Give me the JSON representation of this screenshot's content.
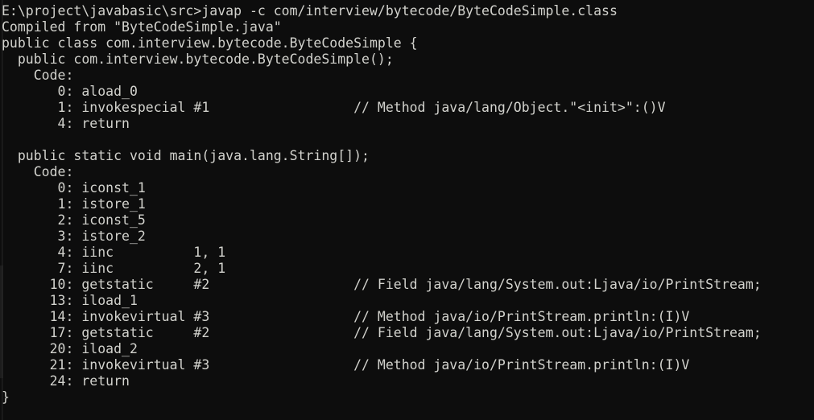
{
  "terminal": {
    "window_title": "javap -c com/interview/bytecode/ByteCodeSimple.class",
    "background_color": "#0d0d0d",
    "foreground_color": "#d2d2cd",
    "prompt_path": "E:\\project\\javabasic\\src",
    "prompt_symbol": ">",
    "command": "javap -c com/interview/bytecode/ByteCodeSimple.class",
    "lines": [
      "E:\\project\\javabasic\\src>javap -c com/interview/bytecode/ByteCodeSimple.class",
      "Compiled from \"ByteCodeSimple.java\"",
      "public class com.interview.bytecode.ByteCodeSimple {",
      "  public com.interview.bytecode.ByteCodeSimple();",
      "    Code:",
      "       0: aload_0",
      "       1: invokespecial #1                  // Method java/lang/Object.\"<init>\":()V",
      "       4: return",
      "",
      "  public static void main(java.lang.String[]);",
      "    Code:",
      "       0: iconst_1",
      "       1: istore_1",
      "       2: iconst_5",
      "       3: istore_2",
      "       4: iinc          1, 1",
      "       7: iinc          2, 1",
      "      10: getstatic     #2                  // Field java/lang/System.out:Ljava/io/PrintStream;",
      "      13: iload_1",
      "      14: invokevirtual #3                  // Method java/io/PrintStream.println:(I)V",
      "      17: getstatic     #2                  // Field java/lang/System.out:Ljava/io/PrintStream;",
      "      20: iload_2",
      "      21: invokevirtual #3                  // Method java/io/PrintStream.println:(I)V",
      "      24: return",
      "}"
    ]
  },
  "disassembly": {
    "source_file": "ByteCodeSimple.java",
    "class_declaration": "public class com.interview.bytecode.ByteCodeSimple {",
    "class_name": "com.interview.bytecode.ByteCodeSimple",
    "closing_brace": "}",
    "methods": [
      {
        "signature": "public com.interview.bytecode.ByteCodeSimple();",
        "code_label": "Code:",
        "instructions": [
          {
            "offset": "0",
            "mnemonic": "aload_0",
            "operand": "",
            "comment": ""
          },
          {
            "offset": "1",
            "mnemonic": "invokespecial",
            "operand": "#1",
            "comment": "// Method java/lang/Object.\"<init>\":()V"
          },
          {
            "offset": "4",
            "mnemonic": "return",
            "operand": "",
            "comment": ""
          }
        ]
      },
      {
        "signature": "public static void main(java.lang.String[]);",
        "code_label": "Code:",
        "instructions": [
          {
            "offset": "0",
            "mnemonic": "iconst_1",
            "operand": "",
            "comment": ""
          },
          {
            "offset": "1",
            "mnemonic": "istore_1",
            "operand": "",
            "comment": ""
          },
          {
            "offset": "2",
            "mnemonic": "iconst_5",
            "operand": "",
            "comment": ""
          },
          {
            "offset": "3",
            "mnemonic": "istore_2",
            "operand": "",
            "comment": ""
          },
          {
            "offset": "4",
            "mnemonic": "iinc",
            "operand": "1, 1",
            "comment": ""
          },
          {
            "offset": "7",
            "mnemonic": "iinc",
            "operand": "2, 1",
            "comment": ""
          },
          {
            "offset": "10",
            "mnemonic": "getstatic",
            "operand": "#2",
            "comment": "// Field java/lang/System.out:Ljava/io/PrintStream;"
          },
          {
            "offset": "13",
            "mnemonic": "iload_1",
            "operand": "",
            "comment": ""
          },
          {
            "offset": "14",
            "mnemonic": "invokevirtual",
            "operand": "#3",
            "comment": "// Method java/io/PrintStream.println:(I)V"
          },
          {
            "offset": "17",
            "mnemonic": "getstatic",
            "operand": "#2",
            "comment": "// Field java/lang/System.out:Ljava/io/PrintStream;"
          },
          {
            "offset": "20",
            "mnemonic": "iload_2",
            "operand": "",
            "comment": ""
          },
          {
            "offset": "21",
            "mnemonic": "invokevirtual",
            "operand": "#3",
            "comment": "// Method java/io/PrintStream.println:(I)V"
          },
          {
            "offset": "24",
            "mnemonic": "return",
            "operand": "",
            "comment": ""
          }
        ]
      }
    ]
  }
}
